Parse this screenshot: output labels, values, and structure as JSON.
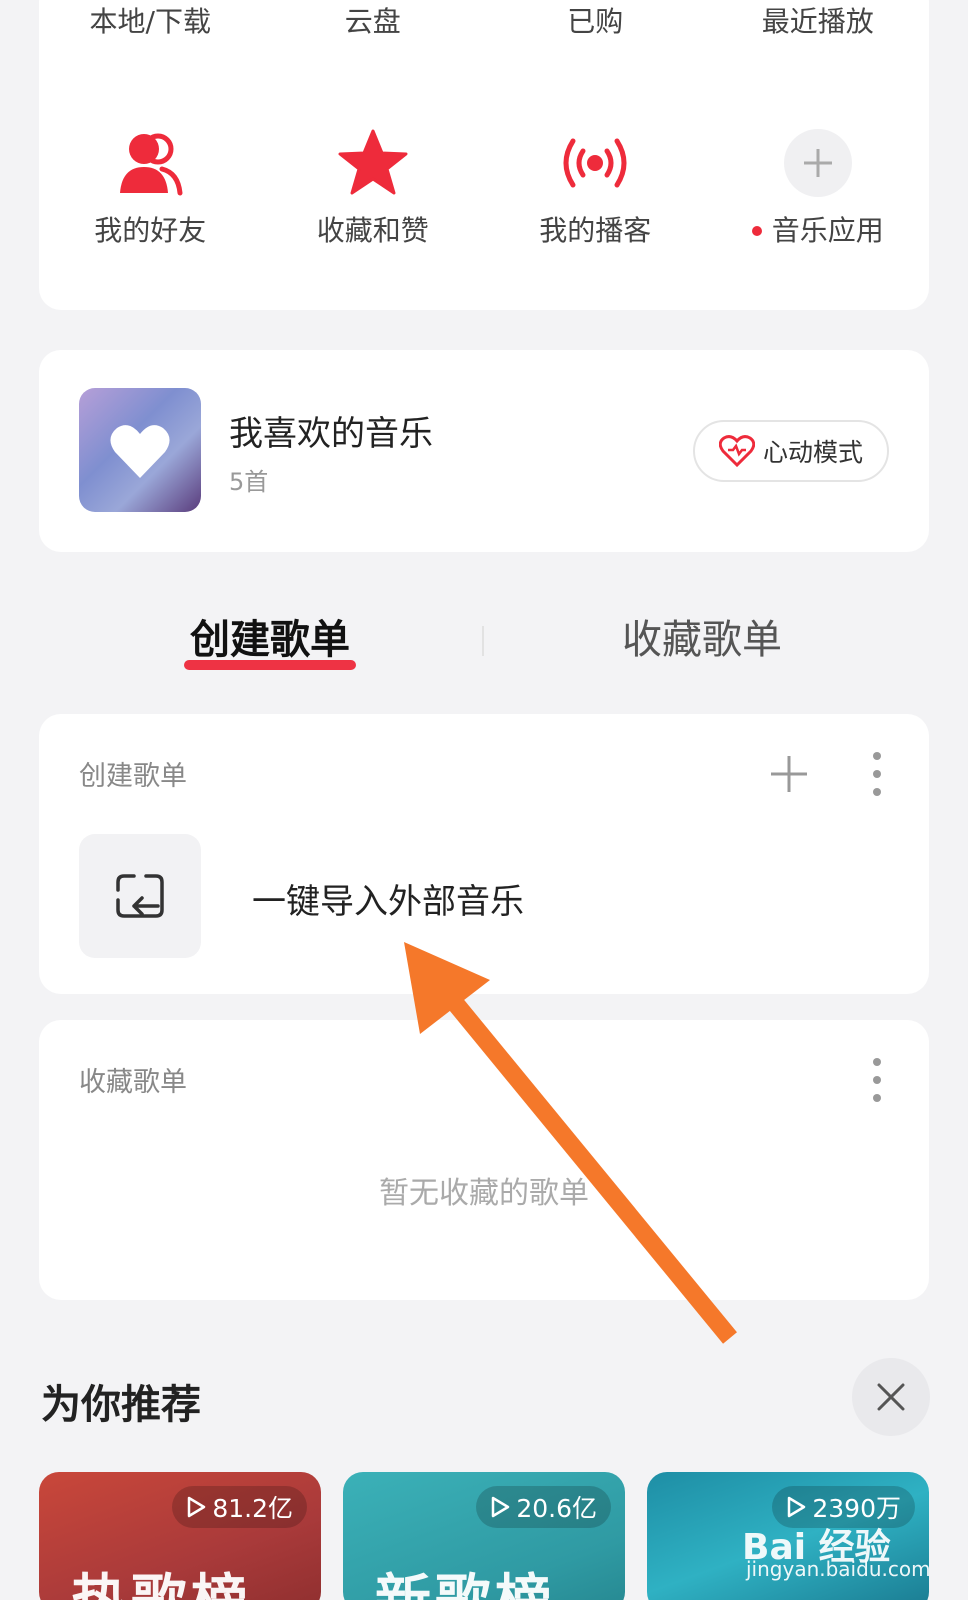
{
  "top_shortcuts": [
    "本地/下载",
    "云盘",
    "已购",
    "最近播放"
  ],
  "icon_shortcuts": [
    {
      "label": "我的好友",
      "icon": "friends-icon"
    },
    {
      "label": "收藏和赞",
      "icon": "star-icon"
    },
    {
      "label": "我的播客",
      "icon": "podcast-icon"
    },
    {
      "label": "音乐应用",
      "icon": "plus-icon"
    }
  ],
  "liked": {
    "title": "我喜欢的音乐",
    "count": "5首",
    "mode_label": "心动模式"
  },
  "tabs": {
    "created": "创建歌单",
    "collected": "收藏歌单"
  },
  "created_section": {
    "header": "创建歌单",
    "import_label": "一键导入外部音乐"
  },
  "collected_section": {
    "header": "收藏歌单",
    "empty_text": "暂无收藏的歌单"
  },
  "recommend": {
    "title": "为你推荐",
    "cards": [
      {
        "plays": "81.2亿",
        "title": "热歌榜"
      },
      {
        "plays": "20.6亿",
        "title": "新歌榜"
      },
      {
        "plays": "2390万",
        "title": ""
      }
    ]
  },
  "watermark": {
    "brand": "Bai 经验",
    "url": "jingyan.baidu.com"
  },
  "colors": {
    "accent": "#ee2b3b",
    "arrow": "#f5782a"
  }
}
